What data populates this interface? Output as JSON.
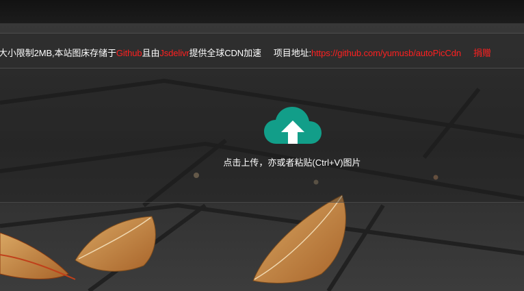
{
  "notice": {
    "size_limit": "大小限制2MB,本站图床存储于",
    "github": "Github",
    "and_by": "且由",
    "jsdelivr": "Jsdelivr",
    "cdn_text": "提供全球CDN加速",
    "project_label": "项目地址:",
    "project_url": "https://github.com/yumusb/autoPicCdn",
    "donate": "捐赠"
  },
  "upload": {
    "hint": "点击上传，亦或者粘贴(Ctrl+V)图片"
  },
  "colors": {
    "link_red": "#ff2020",
    "upload_icon_teal": "#129e89"
  },
  "icons": {
    "upload": "cloud-upload-icon"
  }
}
